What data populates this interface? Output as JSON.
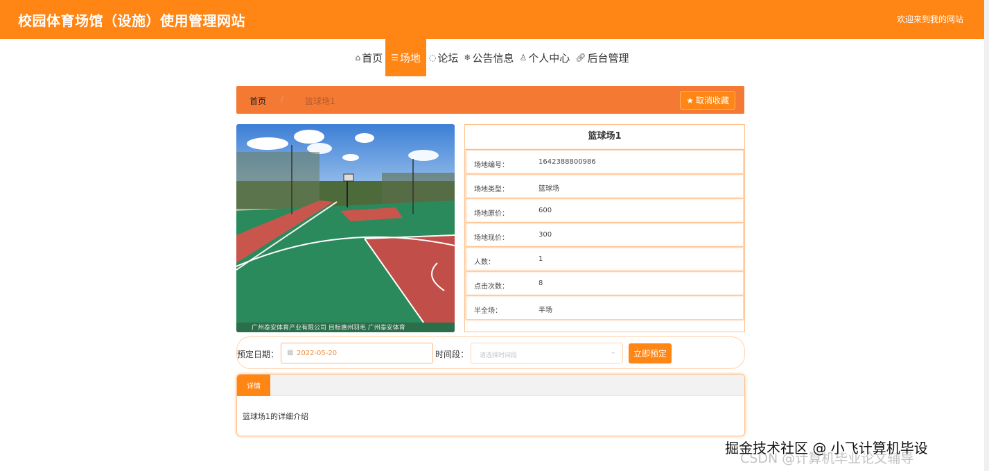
{
  "header": {
    "site_title": "校园体育场馆（设施）使用管理网站",
    "welcome": "欢迎来到我的网站"
  },
  "nav": {
    "items": [
      {
        "icon": "home-icon",
        "glyph": "⌂",
        "label": "首页"
      },
      {
        "icon": "venue-icon",
        "glyph": "☰",
        "label": "场地"
      },
      {
        "icon": "forum-icon",
        "glyph": "◌",
        "label": "论坛"
      },
      {
        "icon": "notice-icon",
        "glyph": "❄",
        "label": "公告信息"
      },
      {
        "icon": "user-icon",
        "glyph": "♙",
        "label": "个人中心"
      },
      {
        "icon": "link-icon",
        "glyph": "🔗",
        "label": "后台管理"
      }
    ],
    "active_index": 1
  },
  "breadcrumb": {
    "home": "首页",
    "separator": "/",
    "current": "篮球场1",
    "favorite_button": "取消收藏"
  },
  "photo": {
    "caption": "广州泰安体育产业有限公司 目标惠州羽毛 广州泰安体育"
  },
  "venue": {
    "title": "篮球场1",
    "fields": [
      {
        "label": "场地编号：",
        "value": "1642388800986"
      },
      {
        "label": "场地类型：",
        "value": "篮球场"
      },
      {
        "label": "场地原价：",
        "value": "600"
      },
      {
        "label": "场地现价：",
        "value": "300"
      },
      {
        "label": "人数：",
        "value": "1"
      },
      {
        "label": "点击次数：",
        "value": "8"
      },
      {
        "label": "半全场：",
        "value": "半场"
      }
    ]
  },
  "booking": {
    "date_label": "预定日期：",
    "date_value": "2022-05-20",
    "slot_label": "时间段：",
    "slot_placeholder": "请选择时间段",
    "submit_label": "立即预定"
  },
  "detail": {
    "tab_label": "详情",
    "content": "篮球场1的详细介绍"
  },
  "watermark": {
    "line1": "掘金技术社区 @ 小飞计算机毕设",
    "line2": "CSDN @计算机毕业论文辅导"
  },
  "colors": {
    "accent": "#ff8514",
    "breadcrumb_bg": "#f47a34",
    "court_green": "#2e8b57",
    "court_red": "#c8534a"
  }
}
